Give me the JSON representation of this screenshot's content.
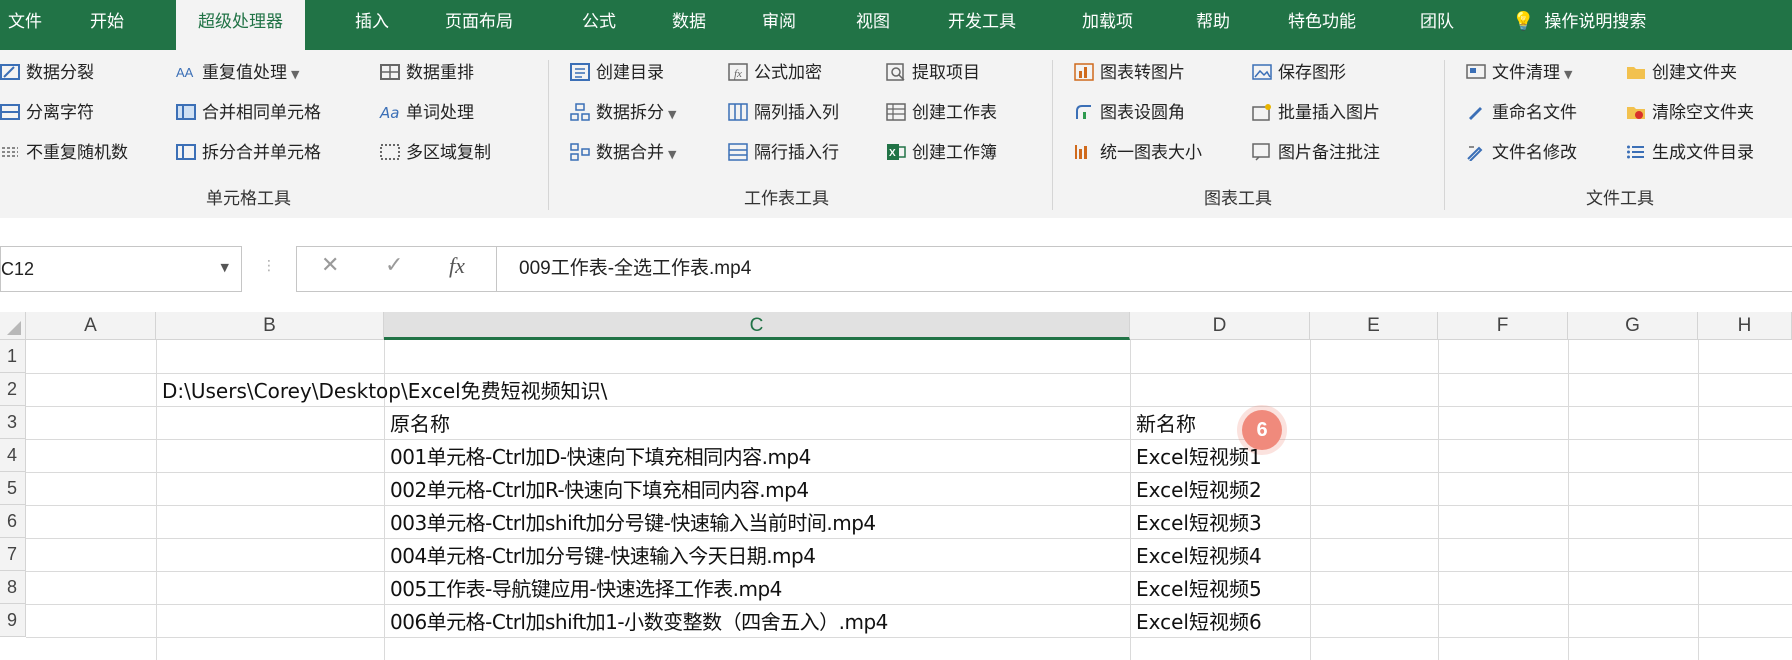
{
  "tabs": [
    "文件",
    "开始",
    "超级处理器",
    "插入",
    "页面布局",
    "公式",
    "数据",
    "审阅",
    "视图",
    "开发工具",
    "加载项",
    "帮助",
    "特色功能",
    "团队",
    "操作说明搜索"
  ],
  "active_tab": "超级处理器",
  "ribbon": {
    "groups": [
      {
        "label": "单元格工具",
        "buttons": [
          "数据分裂",
          "分离字符",
          "不重复随机数",
          "重复值处理",
          "合并相同单元格",
          "拆分合并单元格",
          "数据重排",
          "单词处理",
          "多区域复制"
        ]
      },
      {
        "label": "工作表工具",
        "buttons": [
          "创建目录",
          "数据拆分",
          "数据合并",
          "公式加密",
          "隔列插入列",
          "隔行插入行",
          "提取项目",
          "创建工作表",
          "创建工作簿"
        ]
      },
      {
        "label": "图表工具",
        "buttons": [
          "图表转图片",
          "图表设圆角",
          "统一图表大小",
          "保存图形",
          "批量插入图片",
          "图片备注批注"
        ]
      },
      {
        "label": "文件工具",
        "buttons": [
          "文件清理",
          "重命名文件",
          "文件名修改",
          "创建文件夹",
          "清除空文件夹",
          "生成文件目录"
        ]
      }
    ]
  },
  "formula_bar": {
    "name_box": "C12",
    "formula": "009工作表-全选工作表.mp4",
    "cancel_icon": "✕",
    "enter_icon": "✓",
    "fx_label": "fx"
  },
  "sheet": {
    "columns": [
      "A",
      "B",
      "C",
      "D",
      "E",
      "F",
      "G",
      "H"
    ],
    "selected_column": "C",
    "rows": [
      "1",
      "2",
      "3",
      "4",
      "5",
      "6",
      "7",
      "8",
      "9"
    ],
    "cells": {
      "B2": "D:\\Users\\Corey\\Desktop\\Excel免费短视频知识\\",
      "C3": "原名称",
      "D3": "新名称",
      "C4": "001单元格-Ctrl加D-快速向下填充相同内容.mp4",
      "C5": "002单元格-Ctrl加R-快速向下填充相同内容.mp4",
      "C6": "003单元格-Ctrl加shift加分号键-快速输入当前时间.mp4",
      "C7": "004单元格-Ctrl加分号键-快速输入今天日期.mp4",
      "C8": "005工作表-导航键应用-快速选择工作表.mp4",
      "C9": "006单元格-Ctrl加shift加1-小数变整数（四舍五入）.mp4",
      "D4": "Excel短视频1",
      "D5": "Excel短视频2",
      "D6": "Excel短视频3",
      "D7": "Excel短视频4",
      "D8": "Excel短视频5",
      "D9": "Excel短视频6"
    },
    "step_badge": "6"
  },
  "colors": {
    "accent": "#217346",
    "badge": "#f08a7c"
  }
}
